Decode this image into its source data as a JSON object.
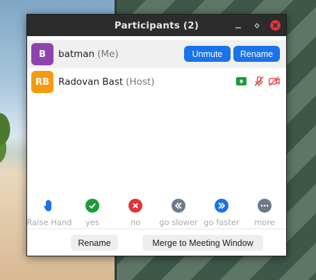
{
  "window": {
    "title": "Participants (2)"
  },
  "participants": [
    {
      "initials": "B",
      "name": "batman",
      "role": "(Me)",
      "avatar_color": "#8e44ad",
      "actions": {
        "unmute": "Unmute",
        "rename": "Rename"
      }
    },
    {
      "initials": "RB",
      "name": "Radovan Bast",
      "role": "(Host)",
      "avatar_color": "#f39c12",
      "status_icons": [
        "screen-share-icon",
        "mic-muted-icon",
        "video-off-icon"
      ]
    }
  ],
  "reactions": [
    {
      "label": "Raise Hand",
      "icon": "raise-hand-icon",
      "color": "#1a73e8"
    },
    {
      "label": "yes",
      "icon": "yes-check-icon",
      "color": "#1e9a3a"
    },
    {
      "label": "no",
      "icon": "no-x-icon",
      "color": "#e0353a"
    },
    {
      "label": "go slower",
      "icon": "go-slower-icon",
      "color": "#6d7a8a"
    },
    {
      "label": "go faster",
      "icon": "go-faster-icon",
      "color": "#1a73e8"
    },
    {
      "label": "more",
      "icon": "more-icon",
      "color": "#6d7a8a"
    }
  ],
  "footer": {
    "rename": "Rename",
    "merge": "Merge to Meeting Window"
  },
  "colors": {
    "accent": "#1a73e8",
    "titlebar": "#2c2c2c",
    "muted_red": "#e0353a"
  }
}
